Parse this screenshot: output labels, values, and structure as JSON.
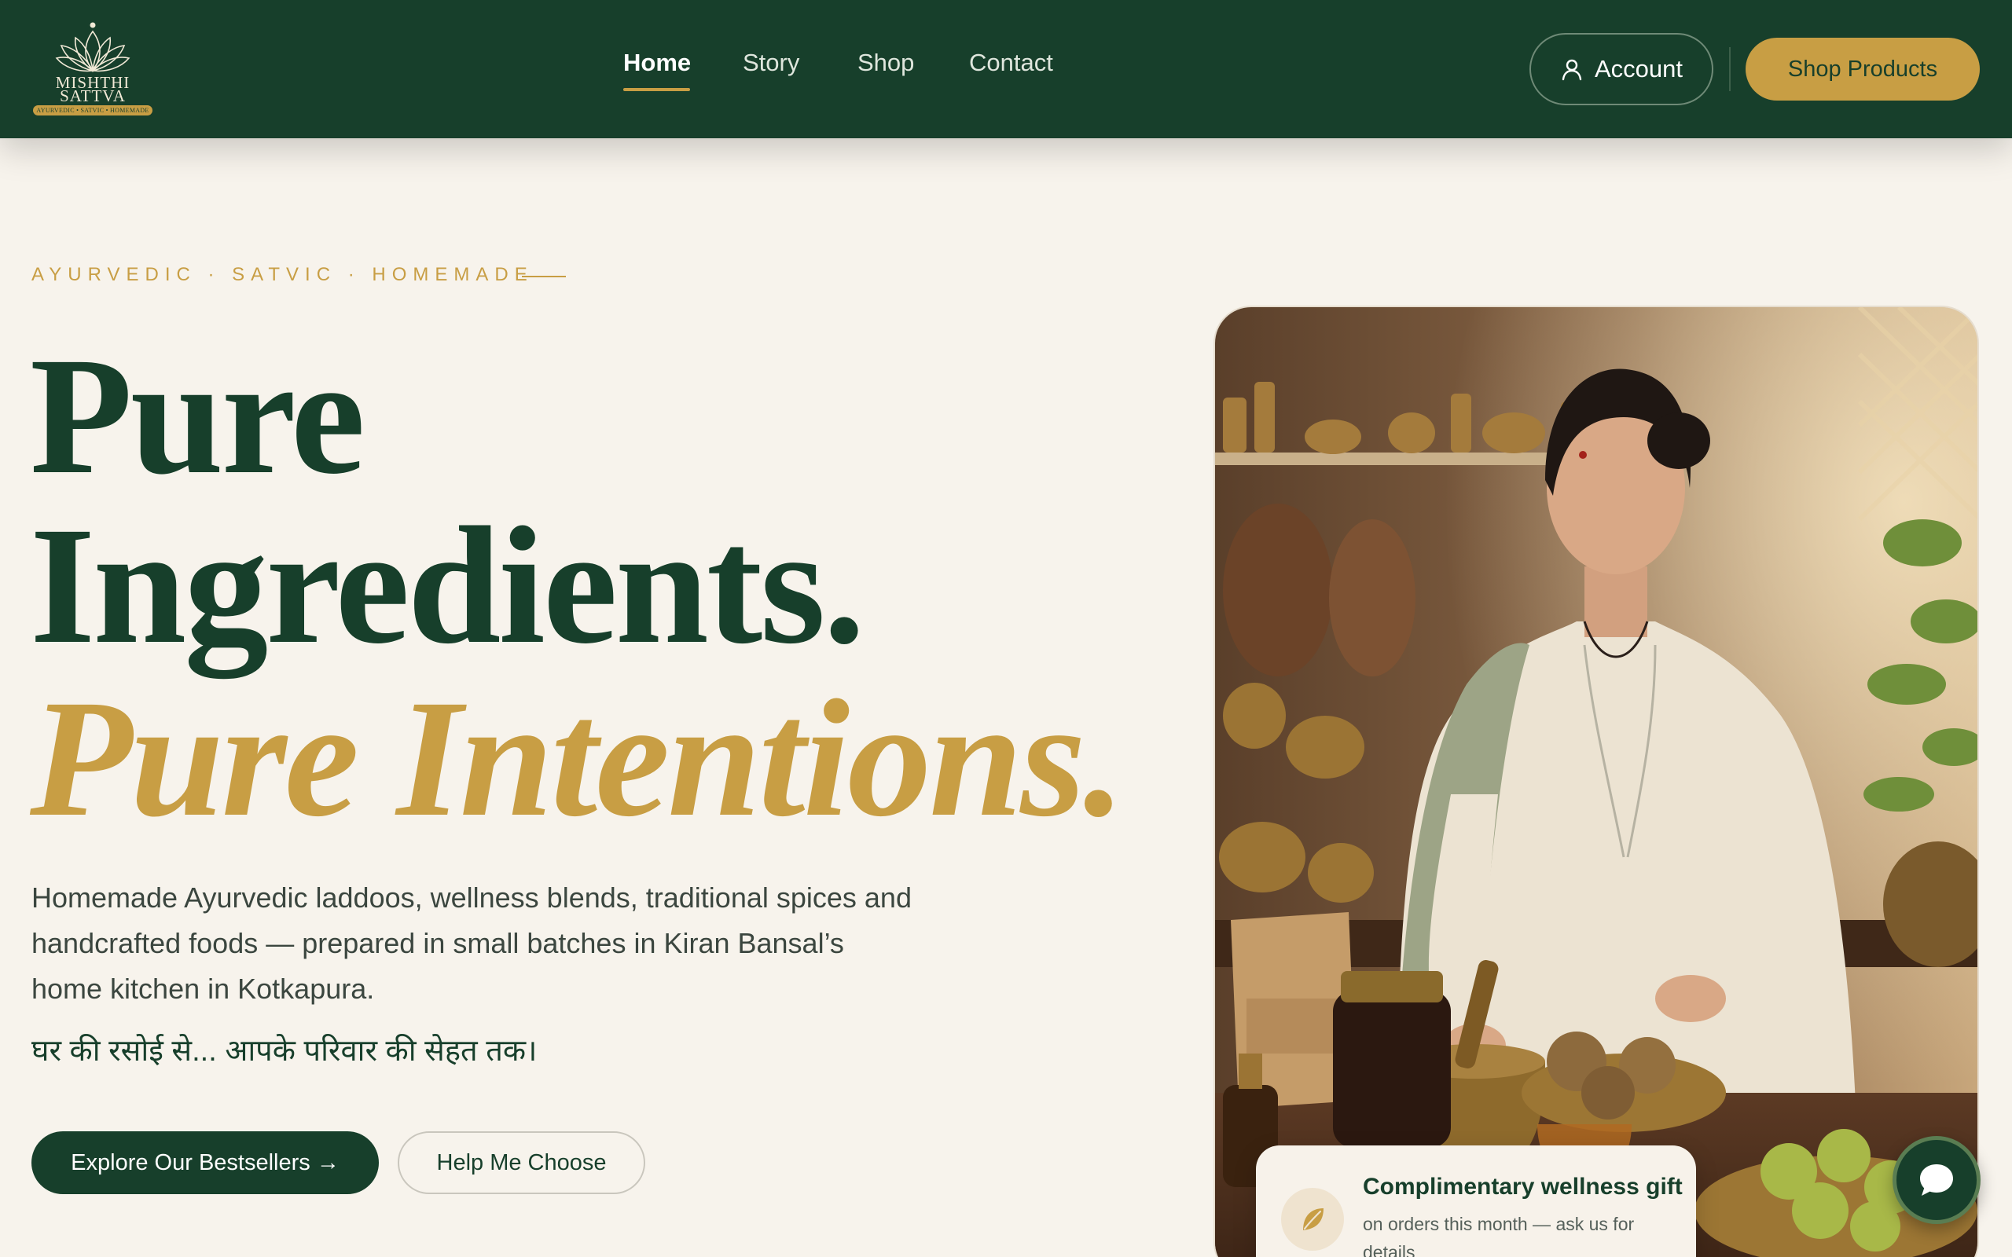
{
  "brand": {
    "name_line1": "MISHTHI",
    "name_line2": "SATTVA",
    "tagline": "AYURVEDIC • SATVIC • HOMEMADE",
    "colors": {
      "primary": "#173f2b",
      "accent": "#c89e44",
      "background": "#f7f3ec"
    }
  },
  "nav": {
    "items": [
      {
        "label": "Home",
        "active": true
      },
      {
        "label": "Story",
        "active": false
      },
      {
        "label": "Shop",
        "active": false
      },
      {
        "label": "Contact",
        "active": false
      }
    ],
    "account_label": "Account",
    "account_icon": "user-icon",
    "shop_label": "Shop Products"
  },
  "hero": {
    "eyebrow": "AYURVEDIC · SATVIC · HOMEMADE",
    "headline_line1": "Pure",
    "headline_line2": "Ingredients.",
    "headline_line3": "Pure Intentions.",
    "description": "Homemade Ayurvedic laddoos, wellness blends, traditional spices and handcrafted foods — prepared in small batches in Kiran Bansal’s home kitchen in Kotkapura.",
    "hindi_tagline": "घर की रसोई से... आपके परिवार की सेहत तक।",
    "cta_primary": "Explore Our Bestsellers →",
    "cta_secondary": "Help Me Choose"
  },
  "promo": {
    "icon": "leaf-icon",
    "title": "Complimentary wellness gift",
    "subtitle": "on orders this month — ask us for details"
  },
  "chat": {
    "icon": "chat-bubble-icon"
  }
}
